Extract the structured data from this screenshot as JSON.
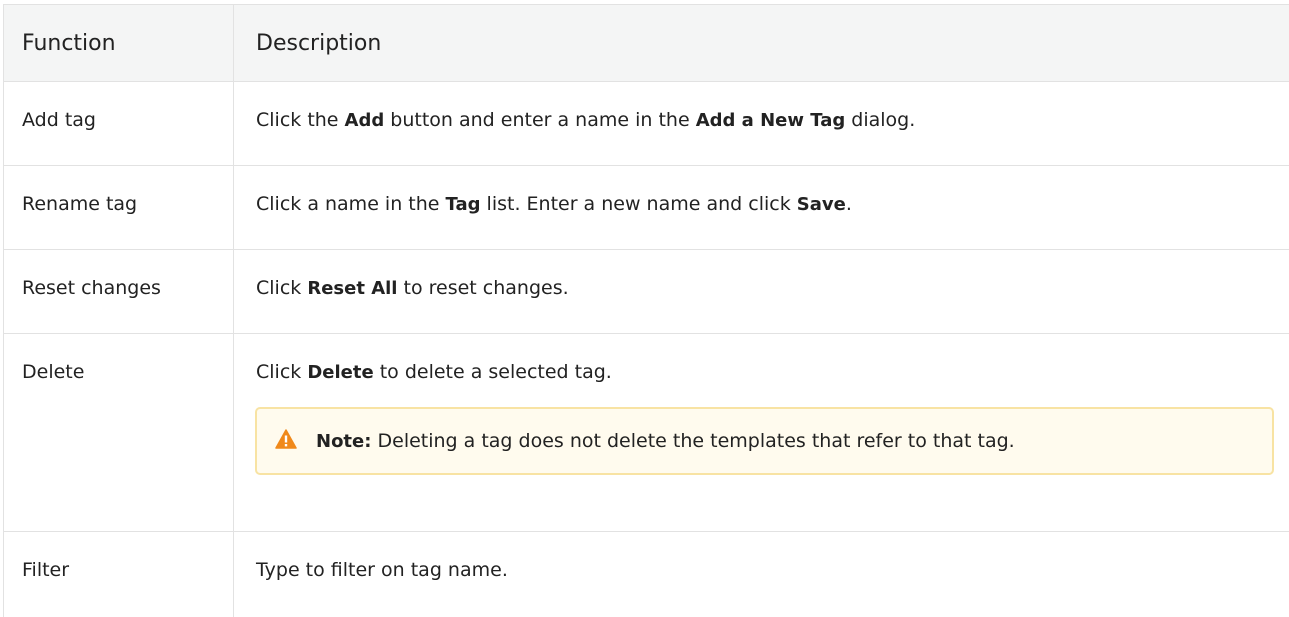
{
  "table": {
    "headers": [
      "Function",
      "Description"
    ],
    "rows": [
      {
        "function": "Add tag",
        "desc": {
          "p1": "Click the ",
          "b1": "Add",
          "p2": " button and enter a name in the ",
          "b2": "Add a New Tag",
          "p3": " dialog."
        }
      },
      {
        "function": "Rename tag",
        "desc": {
          "p1": "Click a name in the ",
          "b1": "Tag",
          "p2": " list. Enter a new name and click ",
          "b2": "Save",
          "p3": "."
        }
      },
      {
        "function": "Reset changes",
        "desc": {
          "p1": "Click ",
          "b1": "Reset All",
          "p2": " to reset changes."
        }
      },
      {
        "function": "Delete",
        "desc": {
          "p1": "Click ",
          "b1": "Delete",
          "p2": " to delete a selected tag."
        },
        "note": {
          "icon": "warning-icon",
          "icon_color": "#f0891a",
          "label": "Note:",
          "text": " Deleting a tag does not delete the templates that refer to that tag."
        }
      },
      {
        "function": "Filter",
        "desc": {
          "p1": "Type to filter on tag name."
        }
      }
    ]
  },
  "colors": {
    "header_bg": "#f4f5f5",
    "border": "#e2e2e2",
    "note_bg": "#fffbee",
    "note_border": "#f8e3a3",
    "warning": "#f0891a"
  }
}
